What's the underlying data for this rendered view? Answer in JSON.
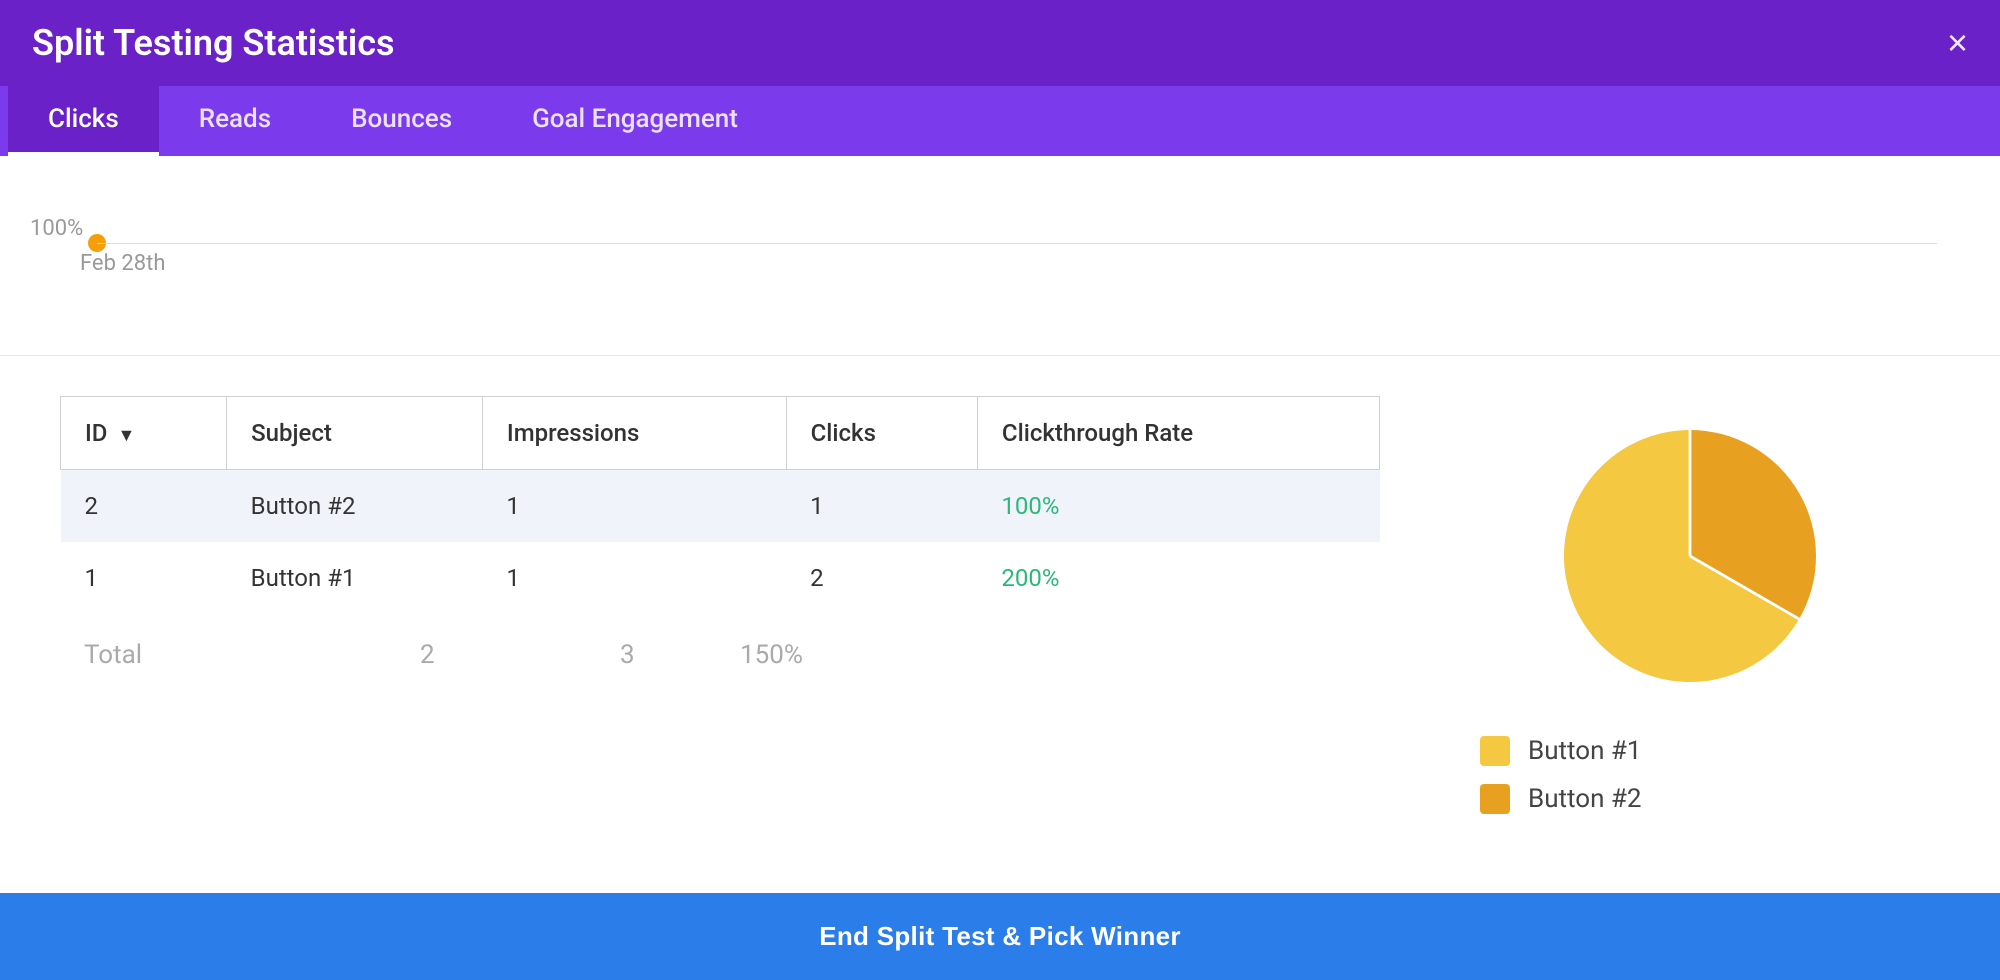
{
  "modal": {
    "title": "Split Testing Statistics",
    "close_label": "×"
  },
  "tabs": [
    {
      "id": "clicks",
      "label": "Clicks",
      "active": true
    },
    {
      "id": "reads",
      "label": "Reads",
      "active": false
    },
    {
      "id": "bounces",
      "label": "Bounces",
      "active": false
    },
    {
      "id": "goal",
      "label": "Goal Engagement",
      "active": false
    }
  ],
  "chart": {
    "y_label": "100%",
    "x_label": "Feb 28th"
  },
  "table": {
    "columns": [
      "ID",
      "Subject",
      "Impressions",
      "Clicks",
      "Clickthrough Rate"
    ],
    "rows": [
      {
        "id": "2",
        "subject": "Button #2",
        "impressions": "1",
        "clicks": "1",
        "rate": "100%"
      },
      {
        "id": "1",
        "subject": "Button #1",
        "impressions": "1",
        "clicks": "2",
        "rate": "200%"
      }
    ],
    "total": {
      "label": "Total",
      "impressions": "2",
      "clicks": "3",
      "rate": "150%"
    }
  },
  "pie": {
    "legend": [
      {
        "label": "Button #1",
        "color": "#f5c842"
      },
      {
        "label": "Button #2",
        "color": "#e8a020"
      }
    ]
  },
  "footer": {
    "button_label": "End Split Test & Pick Winner"
  }
}
